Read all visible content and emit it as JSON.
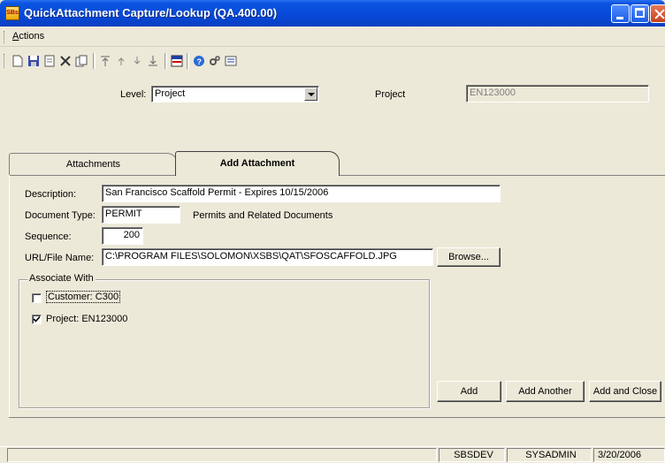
{
  "window": {
    "title": "QuickAttachment Capture/Lookup (QA.400.00)",
    "icon": "sbs-app-icon",
    "icon_text": "SBs"
  },
  "menu": {
    "actions_label": "Actions"
  },
  "toolbar": {
    "icons": [
      "new-document-icon",
      "save-icon",
      "edit-icon",
      "delete-icon",
      "copy-icon",
      "first-record-icon",
      "previous-record-icon",
      "next-record-icon",
      "last-record-icon",
      "table-view-icon",
      "help-icon",
      "tools-icon",
      "note-icon"
    ]
  },
  "header": {
    "level_label": "Level:",
    "level_value": "Project",
    "project_label": "Project",
    "project_value": "EN123000"
  },
  "tabs": [
    {
      "label": "Attachments",
      "active": false
    },
    {
      "label": "Add Attachment",
      "active": true
    }
  ],
  "form": {
    "description_label": "Description:",
    "description_value": "San Francisco Scaffold Permit - Expires 10/15/2006",
    "doc_type_label": "Document Type:",
    "doc_type_value": "PERMIT",
    "doc_type_desc": "Permits and Related Documents",
    "sequence_label": "Sequence:",
    "sequence_value": "200",
    "url_label": "URL/File Name:",
    "url_value": "C:\\PROGRAM FILES\\SOLOMON\\XSBS\\QAT\\SFOSCAFFOLD.JPG",
    "browse_label": "Browse..."
  },
  "associate": {
    "title": "Associate With",
    "items": [
      {
        "label": "Customer: C300",
        "checked": false
      },
      {
        "label": "Project: EN123000",
        "checked": true
      }
    ]
  },
  "buttons": {
    "add": "Add",
    "add_another": "Add Another",
    "add_close": "Add and Close"
  },
  "status": {
    "database": "SBSDEV",
    "user": "SYSADMIN",
    "date": "3/20/2006"
  },
  "colors": {
    "titlebar": "#0a55e0",
    "background": "#ece9d8"
  }
}
